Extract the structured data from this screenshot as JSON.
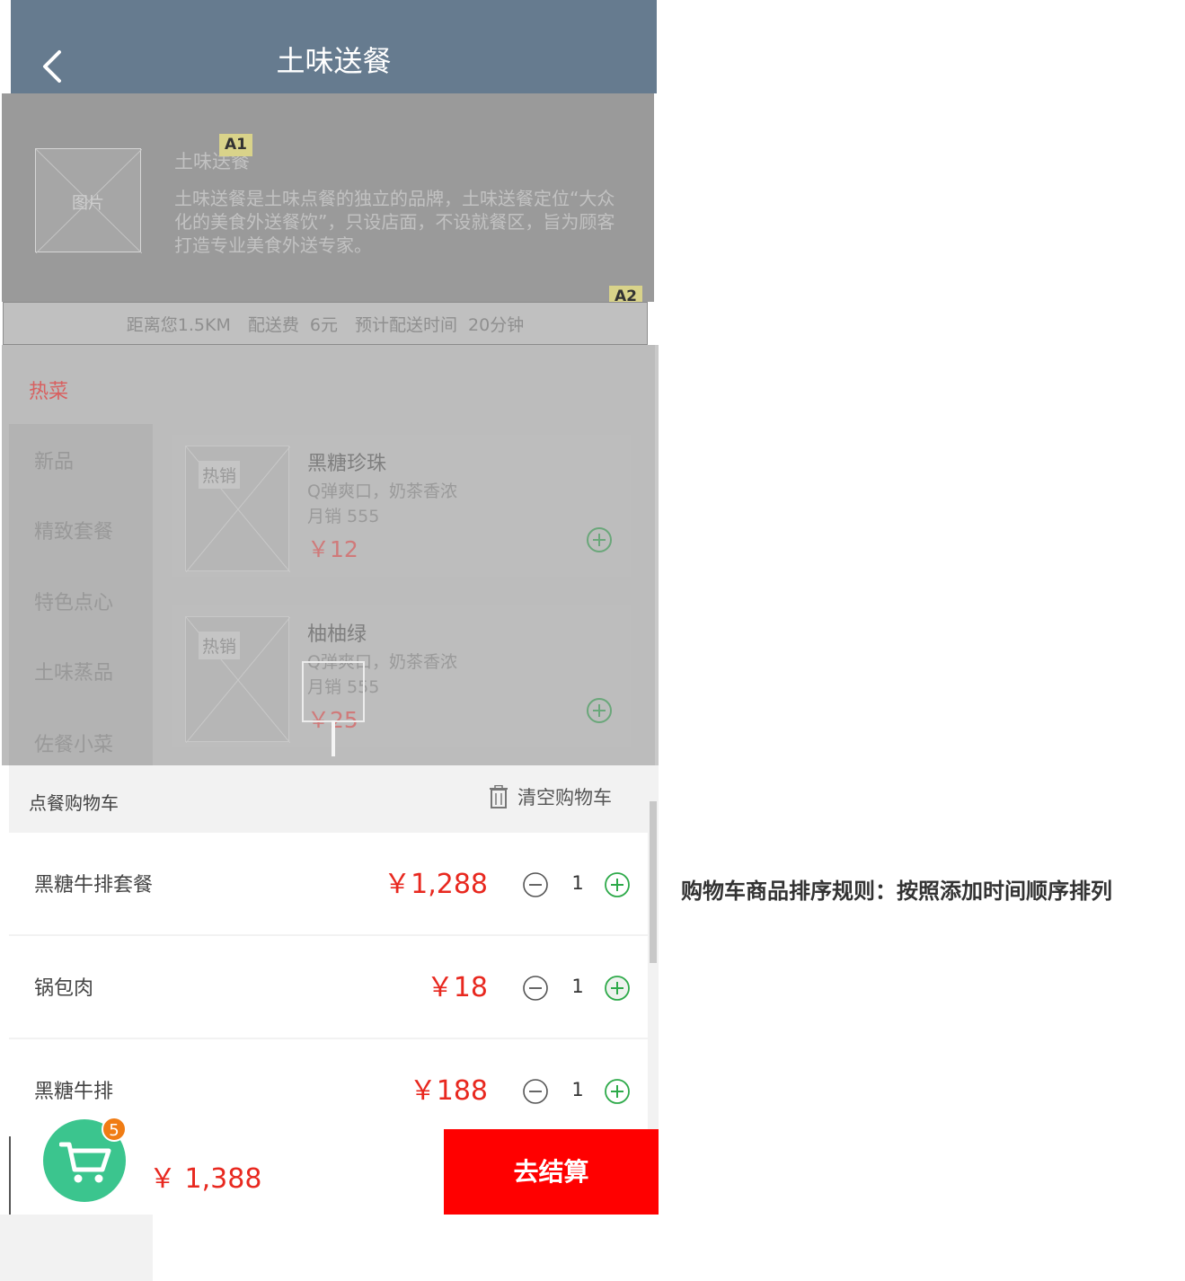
{
  "header": {
    "title": "土味送餐",
    "back_icon": "chevron-left-icon"
  },
  "shop": {
    "image_label": "图片",
    "name": "土味送餐",
    "description": "土味送餐是土味点餐的独立的品牌，土味送餐定位“大众化的美食外送餐饮”，只设店面，不设就餐区，旨为顾客打造专业美食外送专家。",
    "badges": [
      "A1",
      "A2"
    ]
  },
  "info_bar": {
    "text": "距离您1.5KM　配送费 6元　预计配送时间 20分钟"
  },
  "menu": {
    "heading": "热菜",
    "categories": [
      "新品",
      "精致套餐",
      "特色点心",
      "土味蒸品",
      "佐餐小菜"
    ],
    "foods": [
      {
        "tag": "热销",
        "name": "黑糖珍珠",
        "desc": "Q弹爽口，奶茶香浓",
        "sales": "月销 555",
        "price": "￥12"
      },
      {
        "tag": "热销",
        "name": "柚柚绿",
        "desc": "Q弹爽口，奶茶香浓",
        "sales": "月销 555",
        "price": "￥25"
      }
    ]
  },
  "cart": {
    "title": "点餐购物车",
    "clear_label": "清空购物车",
    "items": [
      {
        "name": "黑糖牛排套餐",
        "price": "￥1,288",
        "qty": "1"
      },
      {
        "name": "锅包肉",
        "price": "￥18",
        "qty": "1"
      },
      {
        "name": "黑糖牛排",
        "price": "￥188",
        "qty": "1"
      }
    ]
  },
  "bottom_bar": {
    "cart_count": "5",
    "total": "￥ 1,388",
    "checkout_label": "去结算"
  },
  "annotation": "购物车商品排序规则：按照添加时间顺序排列",
  "colors": {
    "header_bg": "#667b8f",
    "price_red": "#e8281f",
    "checkout_red": "#ff0000",
    "cart_green": "#3bc58e",
    "badge_orange": "#f07c14",
    "plus_green": "#2eaa4a"
  }
}
